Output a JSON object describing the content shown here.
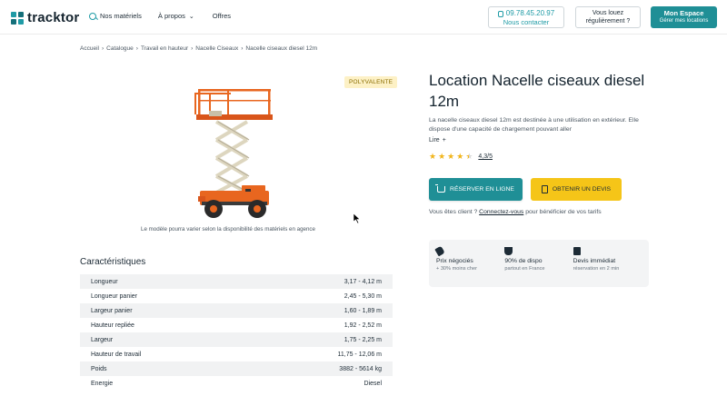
{
  "header": {
    "logo_text": "tracktor",
    "nav": [
      {
        "label": "Nos matériels"
      },
      {
        "label": "À propos"
      },
      {
        "label": "Offres"
      }
    ],
    "phone": {
      "number": "09.78.45.20.97",
      "sub": "Nous contacter"
    },
    "often": {
      "line1": "Vous louez",
      "line2": "régulièrement ?"
    },
    "espace": {
      "line1": "Mon Espace",
      "line2": "Gérer mes locations"
    }
  },
  "breadcrumb": [
    "Accueil",
    "Catalogue",
    "Travail en hauteur",
    "Nacelle Ciseaux",
    "Nacelle ciseaux diesel 12m"
  ],
  "product": {
    "badge": "POLYVALENTE",
    "caption": "Le modèle pourra varier selon la disponibilité des matériels en agence",
    "title": "Location Nacelle ciseaux diesel 12m",
    "description": "La nacelle ciseaux diesel 12m est destinée à une utilisation en extérieur. Elle dispose d'une capacité de chargement pouvant aller",
    "read_more": "Lire",
    "rating": 4.3,
    "rating_label": "4,3/5",
    "reserve_label": "RÉSERVER EN LIGNE",
    "devis_label": "OBTENIR UN DEVIS",
    "client_prefix": "Vous êtes client ?",
    "client_link": "Connectez-vous",
    "client_suffix": "pour bénéficier de vos tarifs"
  },
  "features": [
    {
      "icon": "tag-icon",
      "title": "Prix négociés",
      "sub": "+ 30% moins cher"
    },
    {
      "icon": "trophy-icon",
      "title": "90% de dispo",
      "sub": "partout en France"
    },
    {
      "icon": "calendar-icon",
      "title": "Devis immédiat",
      "sub": "réservation en 2 min"
    }
  ],
  "characteristics": {
    "title": "Caractéristiques",
    "rows": [
      {
        "label": "Longueur",
        "value": "3,17 - 4,12 m"
      },
      {
        "label": "Longueur panier",
        "value": "2,45 - 5,30 m"
      },
      {
        "label": "Largeur panier",
        "value": "1,60 - 1,89 m"
      },
      {
        "label": "Hauteur repliée",
        "value": "1,92 - 2,52 m"
      },
      {
        "label": "Largeur",
        "value": "1,75 - 2,25 m"
      },
      {
        "label": "Hauteur de travail",
        "value": "11,75 - 12,06 m"
      },
      {
        "label": "Poids",
        "value": "3882 - 5614 kg"
      },
      {
        "label": "Energie",
        "value": "Diesel"
      }
    ]
  },
  "colors": {
    "primary": "#1f8f96",
    "accent_yellow": "#f5c518",
    "machine_orange": "#e8661f",
    "text_dark": "#14232e"
  }
}
